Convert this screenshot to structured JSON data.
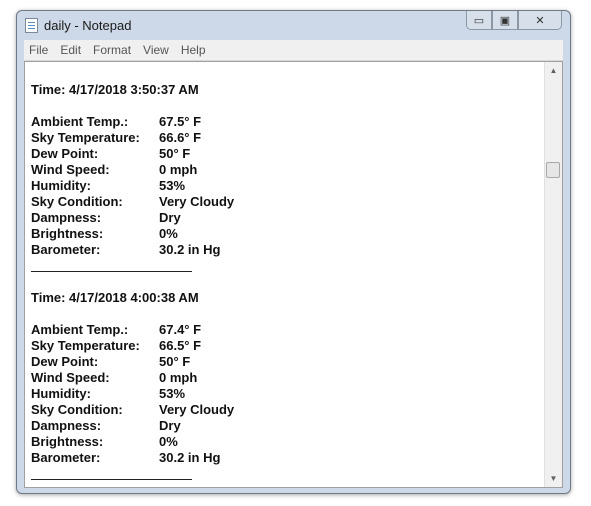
{
  "window": {
    "title": "daily - Notepad"
  },
  "controls": {
    "minimize": "▭",
    "maximize": "▣",
    "close": "✕"
  },
  "menu": {
    "file": "File",
    "edit": "Edit",
    "format": "Format",
    "view": "View",
    "help": "Help"
  },
  "scroll": {
    "up": "▲",
    "down": "▼"
  },
  "labels": {
    "ambient": "Ambient Temp.:",
    "sky_temp": "Sky Temperature:",
    "dew": "Dew Point:",
    "wind": "Wind Speed:",
    "humidity": "Humidity:",
    "sky_cond": "Sky Condition:",
    "dampness": "Dampness:",
    "brightness": "Brightness:",
    "barometer": "Barometer:"
  },
  "records": [
    {
      "time": "Time: 4/17/2018 3:50:37 AM",
      "ambient": "67.5° F",
      "sky_temp": "66.6° F",
      "dew": "50° F",
      "wind": "0 mph",
      "humidity": "53%",
      "sky_cond": "Very Cloudy",
      "dampness": "Dry",
      "brightness": "0%",
      "barometer": "30.2 in Hg"
    },
    {
      "time": "Time: 4/17/2018 4:00:38 AM",
      "ambient": "67.4° F",
      "sky_temp": "66.5° F",
      "dew": "50° F",
      "wind": "0 mph",
      "humidity": "53%",
      "sky_cond": "Very Cloudy",
      "dampness": "Dry",
      "brightness": "0%",
      "barometer": "30.2 in Hg"
    }
  ]
}
